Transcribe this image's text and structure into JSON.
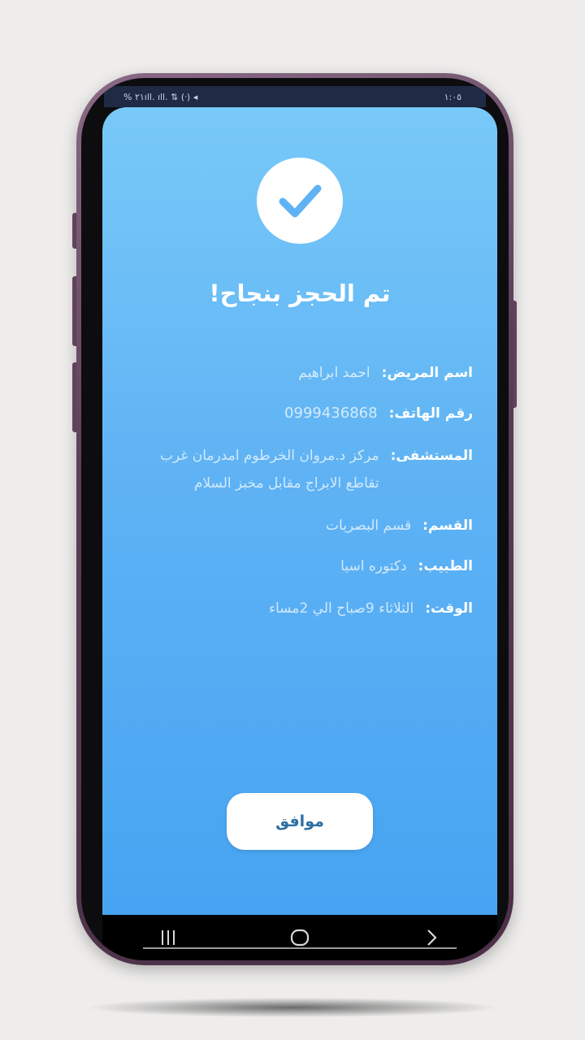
{
  "statusbar": {
    "left": "%٢١ ‏ıll. ıll. ⇅ (ᐧ) ◂",
    "right": "١:٠٥"
  },
  "dialog": {
    "title": "!تم الحجز بنجاح",
    "icon": "check-icon",
    "fields": [
      {
        "label": "اسم المريض:",
        "value": "احمد ابراهيم"
      },
      {
        "label": "رقم الهاتف:",
        "value": "0999436868"
      },
      {
        "label": "المستشفى:",
        "value": "مركز د.مروان الخرطوم امدرمان غرب تقاطع الابراج مقابل مخبز السلام"
      },
      {
        "label": "القسم:",
        "value": "قسم البصريات"
      },
      {
        "label": "الطبيب:",
        "value": "دكتوره اسيا"
      },
      {
        "label": "الوقت:",
        "value": "الثلاثاء 9صباح الي 2مساء"
      }
    ],
    "ok_label": "موافق"
  },
  "navbar": {
    "recents_icon": "recent-apps-icon",
    "home_icon": "home-icon",
    "back_icon": "back-icon"
  },
  "colors": {
    "gradient_top": "#78c9f8",
    "gradient_bottom": "#47a4f2",
    "button_text": "#2d6fa3"
  }
}
